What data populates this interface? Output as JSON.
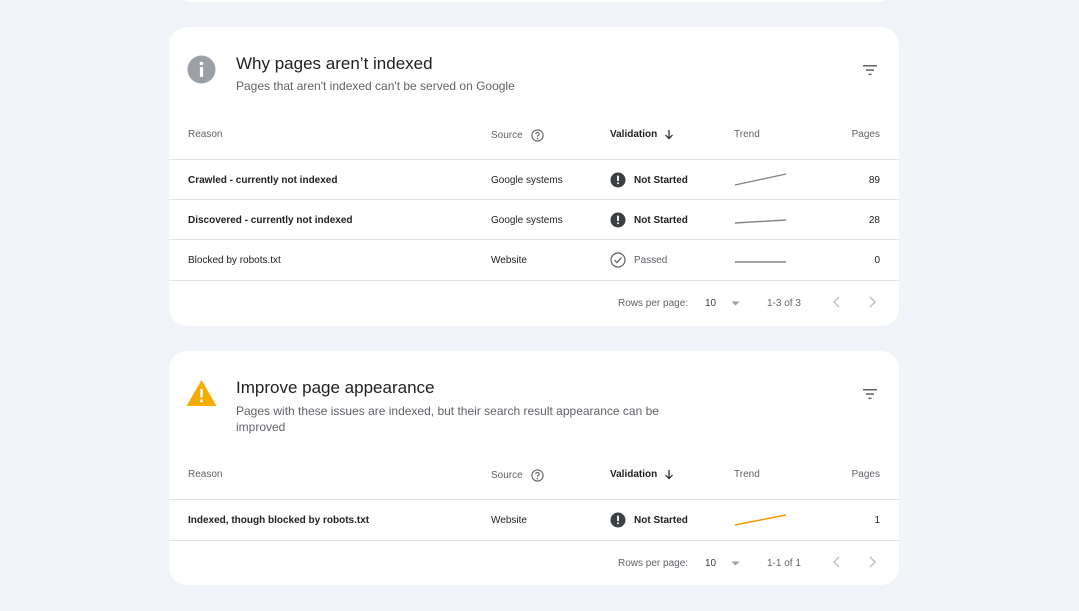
{
  "colors": {
    "not_started_icon": "#3c4043",
    "trend_gray": "#80868b",
    "trend_orange": "#f29900",
    "warning_icon": "#f9ab00",
    "info_icon": "#9aa0a6"
  },
  "cards": [
    {
      "title": "Why pages aren’t indexed",
      "subtitle": "Pages that aren't indexed can't be served on Google",
      "icon": "info-icon",
      "headers": {
        "reason": "Reason",
        "source": "Source",
        "validation": "Validation",
        "trend": "Trend",
        "pages": "Pages"
      },
      "rows": [
        {
          "reason": "Crawled - currently not indexed",
          "source": "Google systems",
          "validation": "Not Started",
          "status_icon": "not-started-icon",
          "trend": "rising",
          "pages": "89"
        },
        {
          "reason": "Discovered - currently not indexed",
          "source": "Google systems",
          "validation": "Not Started",
          "status_icon": "not-started-icon",
          "trend": "slight-rise",
          "pages": "28"
        },
        {
          "reason": "Blocked by robots.txt",
          "source": "Website",
          "validation": "Passed",
          "status_icon": "passed-check-icon",
          "trend": "flat",
          "pages": "0"
        }
      ],
      "footer": {
        "rows_per_page_label": "Rows per page:",
        "rows_per_page": "10",
        "range": "1-3 of 3"
      }
    },
    {
      "title": "Improve page appearance",
      "subtitle": "Pages with these issues are indexed, but their search result appearance can be improved",
      "icon": "warning-icon",
      "headers": {
        "reason": "Reason",
        "source": "Source",
        "validation": "Validation",
        "trend": "Trend",
        "pages": "Pages"
      },
      "rows": [
        {
          "reason": "Indexed, though blocked by robots.txt",
          "source": "Website",
          "validation": "Not Started",
          "status_icon": "not-started-icon",
          "trend": "rising",
          "pages": "1"
        }
      ],
      "footer": {
        "rows_per_page_label": "Rows per page:",
        "rows_per_page": "10",
        "range": "1-1 of 1"
      }
    }
  ]
}
